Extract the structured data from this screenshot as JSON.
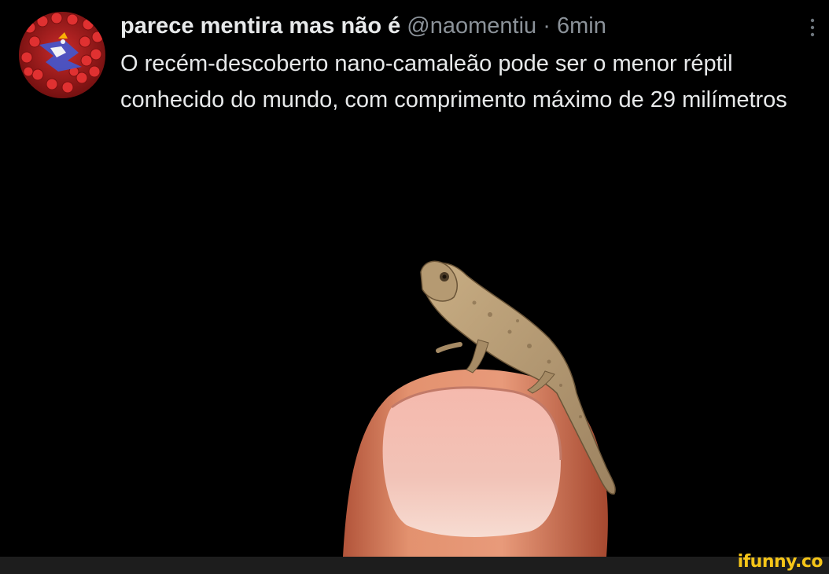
{
  "tweet": {
    "display_name": "parece mentira mas não é",
    "handle": "@naomentiu",
    "separator": "·",
    "timestamp": "6min",
    "text": "O recém-descoberto nano-camaleão pode ser o menor réptil conhecido do mundo, com comprimento máximo de 29 milímetros",
    "avatar_icon": "avatar-photo-red-field",
    "more_icon": "vertical-ellipsis-icon",
    "media_icon": "photo-chameleon-on-fingertip"
  },
  "watermark": {
    "text": "ifunny.co",
    "color": "#f5c518"
  },
  "colors": {
    "background": "#000000",
    "primary_text": "#e7e9ea",
    "secondary_text": "#8b9299"
  }
}
